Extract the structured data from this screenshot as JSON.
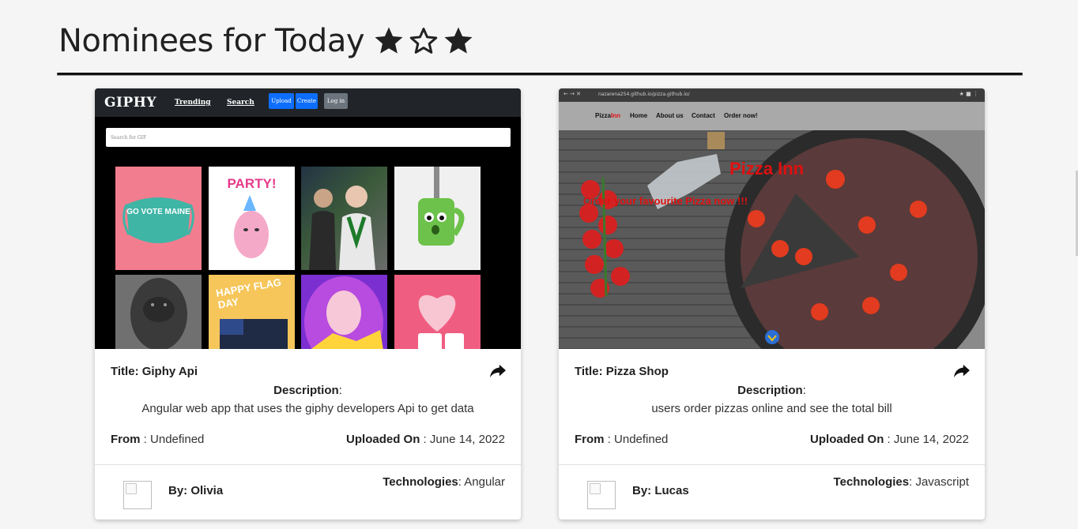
{
  "section": {
    "title": "Nominees for Today",
    "stars": [
      "filled",
      "outline",
      "filled"
    ]
  },
  "cards": [
    {
      "title_label": "Title: Giphy Api",
      "description_label": "Description",
      "description": "Angular web app that uses the giphy developers Api to get data",
      "from_label": "From",
      "from_value": "Undefined",
      "uploaded_label": "Uploaded On",
      "uploaded_value": "June 14, 2022",
      "by": "By: Olivia",
      "technologies_label": "Technologies",
      "technologies_value": "Angular",
      "screenshot": {
        "logo": "GIPHY",
        "links": [
          "Trending",
          "Search"
        ],
        "buttons": [
          "Upload",
          "Create",
          "Log in"
        ],
        "search_placeholder": "Search for GIF",
        "tiles": [
          "GO VOTE MAINE",
          "PARTY!",
          "",
          "",
          "",
          "HAPPY FLAG DAY",
          "",
          ""
        ]
      }
    },
    {
      "title_label": "Title: Pizza Shop",
      "description_label": "Description",
      "description": "users order pizzas online and see the total bill",
      "from_label": "From",
      "from_value": "Undefined",
      "uploaded_label": "Uploaded On",
      "uploaded_value": "June 14, 2022",
      "by": "By: Lucas",
      "technologies_label": "Technologies",
      "technologies_value": "Javascript",
      "screenshot": {
        "url": "nazarena254.github.io/pizza.github.io/",
        "brand_a": "Pizza",
        "brand_b": "Inn",
        "nav": [
          "Home",
          "About us",
          "Contact",
          "Order now!"
        ],
        "hero_title": "Pizza Inn",
        "hero_sub": "Order your favourite Pizza now !!!"
      }
    }
  ],
  "colors": {
    "page_bg": "#f5f5f5",
    "accent_red": "#e01010",
    "giphy_btn_blue": "#0d6efd",
    "giphy_btn_gray": "#6c757d"
  }
}
